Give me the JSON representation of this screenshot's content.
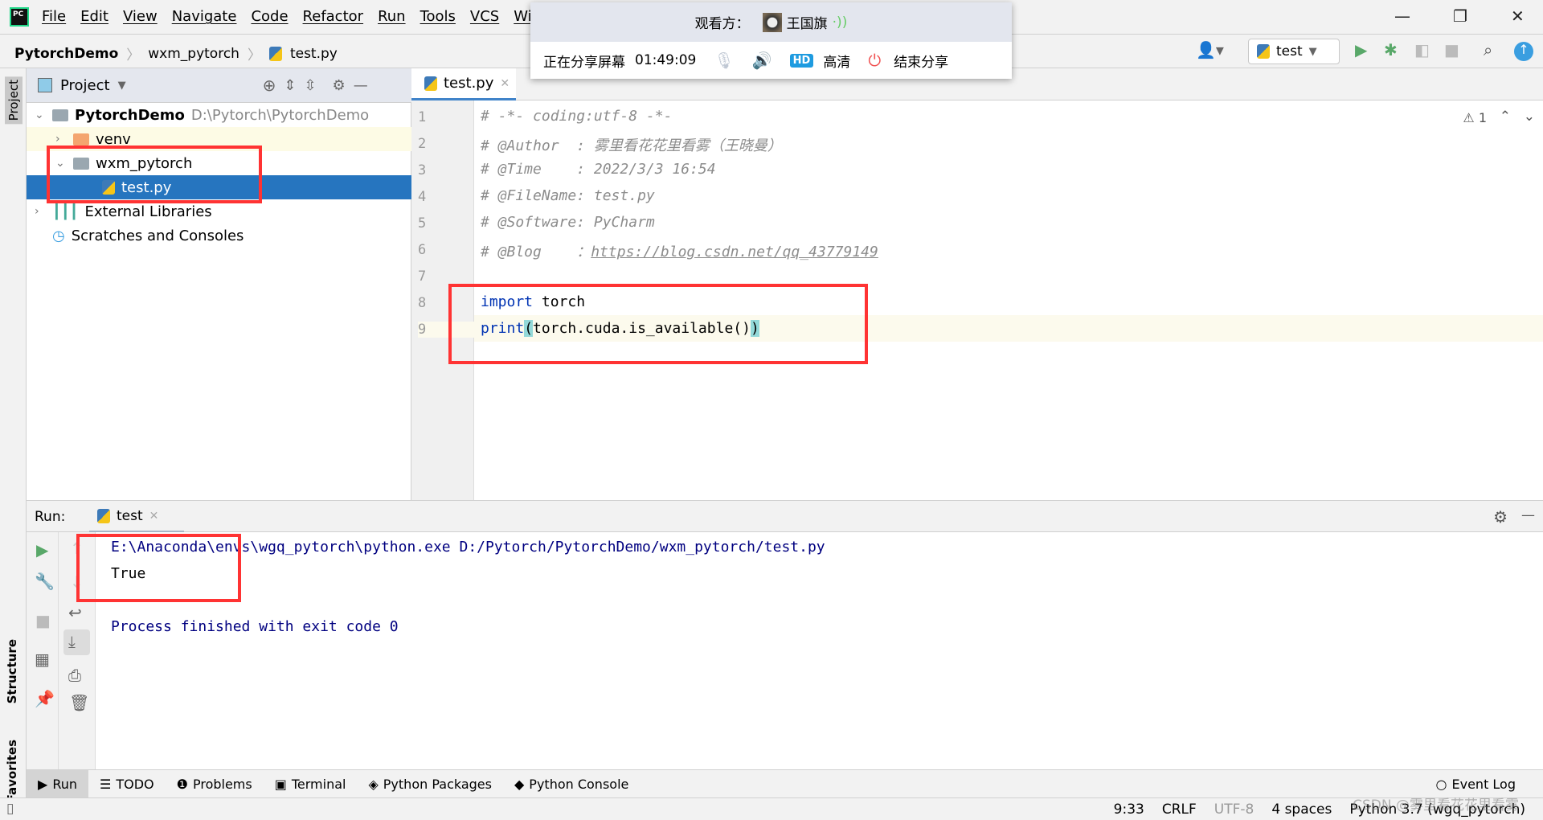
{
  "menu": {
    "items": [
      "File",
      "Edit",
      "View",
      "Navigate",
      "Code",
      "Refactor",
      "Run",
      "Tools",
      "VCS",
      "Wi"
    ]
  },
  "breadcrumb": [
    "PytorchDemo",
    "wxm_pytorch",
    "test.py"
  ],
  "run_config": "test",
  "project_panel": {
    "title": "Project",
    "tree": [
      {
        "label": "PytorchDemo",
        "path": "D:\\Pytorch\\PytorchDemo"
      },
      {
        "label": "venv"
      },
      {
        "label": "wxm_pytorch"
      },
      {
        "label": "test.py"
      },
      {
        "label": "External Libraries"
      },
      {
        "label": "Scratches and Consoles"
      }
    ]
  },
  "side_tabs": {
    "project": "Project",
    "structure": "Structure",
    "favorites": "Favorites"
  },
  "editor": {
    "tab": "test.py",
    "warnings": "1",
    "lines": [
      "1",
      "2",
      "3",
      "4",
      "5",
      "6",
      "7",
      "8",
      "9"
    ],
    "code": {
      "l1": "# -*- coding:utf-8 -*-",
      "l2": "# @Author  : 雾里看花花里看雾（王晓曼）",
      "l3": "# @Time    : 2022/3/3 16:54",
      "l4": "# @FileName: test.py",
      "l5": "# @Software: PyCharm",
      "l6a": "# @Blog    ：",
      "l6b": "https://blog.csdn.net/qq_43779149",
      "l8kw": "import",
      "l8": " torch",
      "l9a": "print",
      "l9b": "(",
      "l9c": "torch.cuda.is_available()",
      "l9d": ")"
    }
  },
  "run_panel": {
    "label": "Run:",
    "tab": "test",
    "output": [
      "E:\\Anaconda\\envs\\wgq_pytorch\\python.exe D:/Pytorch/PytorchDemo/wxm_pytorch/test.py",
      "True",
      "Process finished with exit code 0"
    ]
  },
  "bottom_tools": [
    "Run",
    "TODO",
    "Problems",
    "Terminal",
    "Python Packages",
    "Python Console"
  ],
  "event_log": "Event Log",
  "status": {
    "position": "9:33",
    "line_sep": "CRLF",
    "encoding": "UTF-8",
    "indent": "4 spaces",
    "interpreter": "Python 3.7 (wgq_pytorch)",
    "watermark": "CSDN @雾里看花花里看雾"
  },
  "share_popup": {
    "viewer_label": "观看方：",
    "viewer_name": "王国旗",
    "sharing": "正在分享屏幕",
    "elapsed": "01:49:09",
    "hd_badge": "HD",
    "hd_label": "高清",
    "end_label": "结束分享"
  },
  "colors": {
    "selection": "#2675bf",
    "annotation": "#ff3333",
    "keyword": "#0033b3",
    "console_text": "#000080",
    "run_green": "#59a869"
  }
}
